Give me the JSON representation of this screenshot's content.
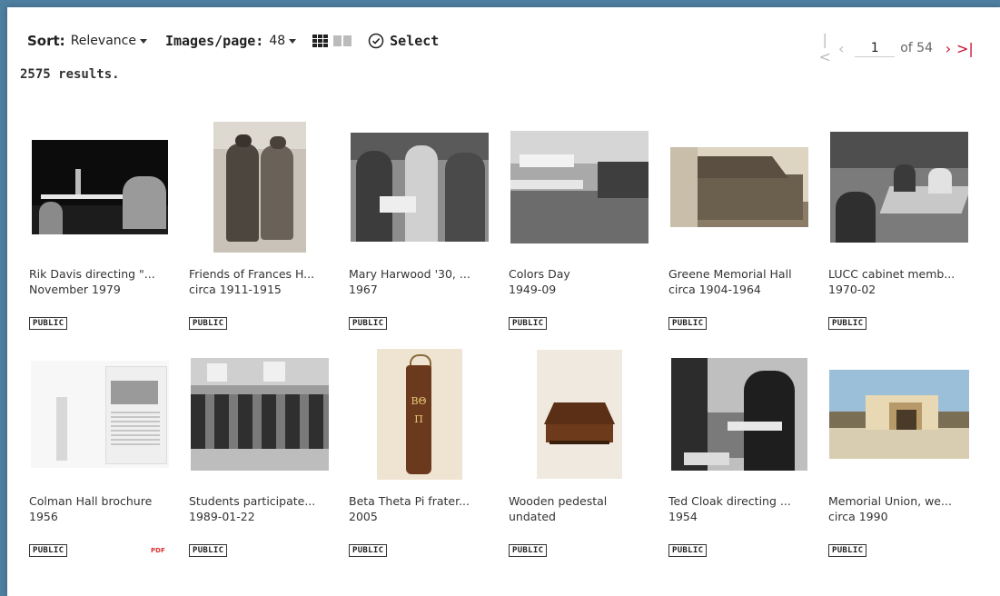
{
  "toolbar": {
    "sort_label": "Sort:",
    "sort_value": "Relevance",
    "ipp_label": "Images/page:",
    "ipp_value": "48",
    "select_label": "Select"
  },
  "pager": {
    "current_page": "1",
    "of_text": "of 54"
  },
  "results_text": "2575 results.",
  "items": [
    {
      "title": "Rik Davis directing \"...",
      "date": "November 1979",
      "badge": "PUBLIC"
    },
    {
      "title": "Friends of Frances H...",
      "date": "circa 1911-1915",
      "badge": "PUBLIC"
    },
    {
      "title": "Mary Harwood '30, ...",
      "date": "1967",
      "badge": "PUBLIC"
    },
    {
      "title": "Colors Day",
      "date": "1949-09",
      "badge": "PUBLIC"
    },
    {
      "title": "Greene Memorial Hall",
      "date": "circa 1904-1964",
      "badge": "PUBLIC"
    },
    {
      "title": "LUCC cabinet memb...",
      "date": "1970-02",
      "badge": "PUBLIC"
    },
    {
      "title": "Colman Hall brochure",
      "date": "1956",
      "badge": "PUBLIC",
      "pdf": "PDF"
    },
    {
      "title": "Students participate...",
      "date": "1989-01-22",
      "badge": "PUBLIC"
    },
    {
      "title": "Beta Theta Pi frater...",
      "date": "2005",
      "badge": "PUBLIC",
      "thumb_text": "ΒΘΠ"
    },
    {
      "title": "Wooden pedestal",
      "date": "undated",
      "badge": "PUBLIC"
    },
    {
      "title": "Ted Cloak directing ...",
      "date": "1954",
      "badge": "PUBLIC"
    },
    {
      "title": "Memorial Union, we...",
      "date": "circa 1990",
      "badge": "PUBLIC"
    }
  ]
}
